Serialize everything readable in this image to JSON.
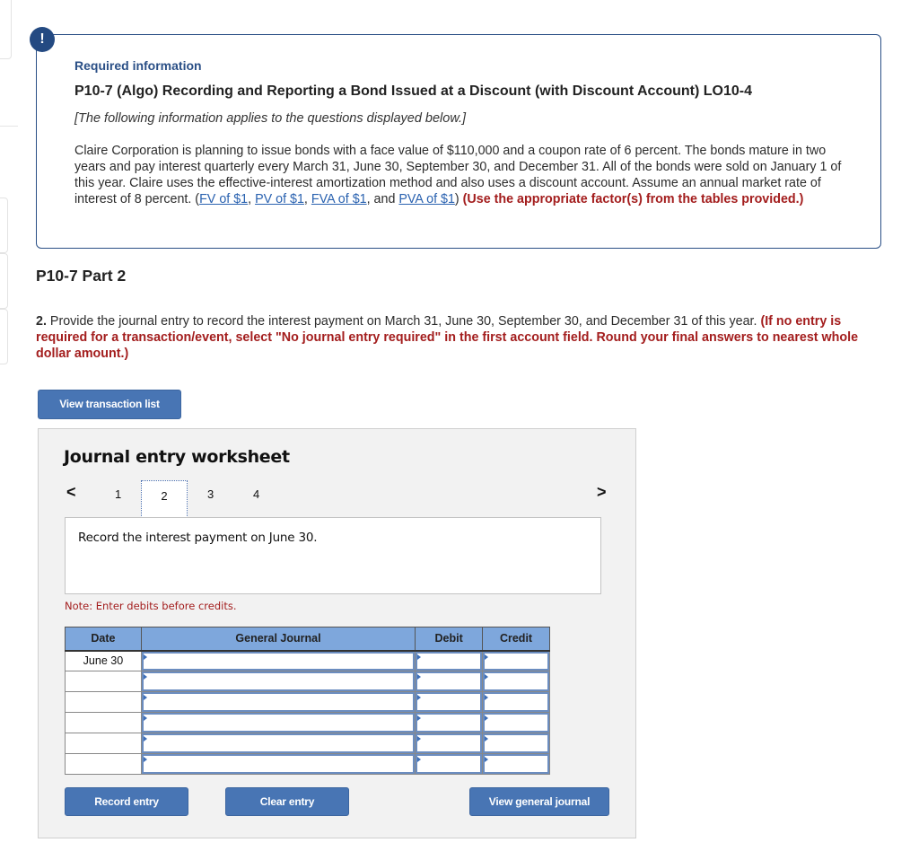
{
  "info": {
    "alert_icon_glyph": "!",
    "heading": "Required information",
    "problem_title": "P10-7 (Algo) Recording and Reporting a Bond Issued at a Discount (with Discount Account) LO10-4",
    "applies_note": "[The following information applies to the questions displayed below.]",
    "body_text": "Claire Corporation is planning to issue bonds with a face value of $110,000 and a coupon rate of 6 percent. The bonds mature in two years and pay interest quarterly every March 31, June 30, September 30, and December 31. All of the bonds were sold on January 1 of this year. Claire uses the effective-interest amortization method and also uses a discount account. Assume an annual market rate of interest of 8 percent. (",
    "links": [
      "FV of $1",
      "PV of $1",
      "FVA of $1",
      "PVA of $1"
    ],
    "link_sep_1": ", ",
    "link_sep_2": ", ",
    "link_sep_3": ", and ",
    "after_links": ") ",
    "instruction": "(Use the appropriate factor(s) from the tables provided.)"
  },
  "part": {
    "title": "P10-7 Part 2",
    "question_number": "2.",
    "question_text": " Provide the journal entry to record the interest payment on March 31, June 30, September 30, and December 31 of this year. ",
    "question_instruction": "(If no entry is required for a transaction/event, select \"No journal entry required\" in the first account field. Round your final answers to nearest whole dollar amount.)"
  },
  "buttons": {
    "view_transaction_list": "View transaction list",
    "record_entry": "Record entry",
    "clear_entry": "Clear entry",
    "view_general_journal": "View general journal"
  },
  "worksheet": {
    "title": "Journal entry worksheet",
    "prev_glyph": "<",
    "next_glyph": ">",
    "pages": [
      "1",
      "2",
      "3",
      "4"
    ],
    "active_page": "2",
    "description": "Record the interest payment on June 30.",
    "note": "Note: Enter debits before credits."
  },
  "journal": {
    "headers": [
      "Date",
      "General Journal",
      "Debit",
      "Credit"
    ],
    "rows": [
      {
        "date": "June 30",
        "account": "",
        "debit": "",
        "credit": ""
      },
      {
        "date": "",
        "account": "",
        "debit": "",
        "credit": ""
      },
      {
        "date": "",
        "account": "",
        "debit": "",
        "credit": ""
      },
      {
        "date": "",
        "account": "",
        "debit": "",
        "credit": ""
      },
      {
        "date": "",
        "account": "",
        "debit": "",
        "credit": ""
      },
      {
        "date": "",
        "account": "",
        "debit": "",
        "credit": ""
      }
    ]
  },
  "colors": {
    "accent_blue": "#2a4f86",
    "button_blue": "#4875b4",
    "header_blue": "#7ea7dc",
    "instruction_red": "#a31d1d",
    "link_blue": "#2a62b0"
  }
}
